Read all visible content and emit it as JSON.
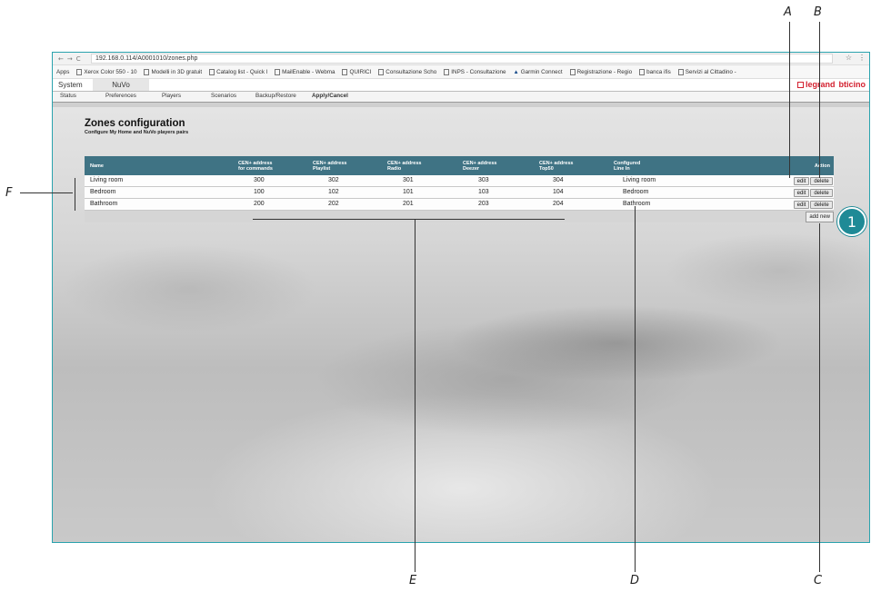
{
  "browser": {
    "url": "192.168.0.114/A0001010/zones.php",
    "bookmarks": [
      "Apps",
      "Xerox Color 550 - 10",
      "Modelli in 3D gratuit",
      "Catalog list - Quick l",
      "MailEnable - Webma",
      "QUIRICI",
      "Consultazione Scho",
      "INPS - Consultazione",
      "Garmin Connect",
      "Registrazione - Regio",
      "banca ifis",
      "Servizi al Cittadino -"
    ]
  },
  "app": {
    "tab_system": "System",
    "tab_nuvo": "NuVo",
    "brand_legrand": "legrand",
    "brand_bticino": "bticino"
  },
  "menu": [
    "Status",
    "Preferences",
    "Players",
    "Scenarios",
    "Backup/Restore",
    "Apply/Cancel"
  ],
  "page": {
    "title": "Zones configuration",
    "subtitle": "Configure My Home and NuVo players pairs"
  },
  "table": {
    "headers": {
      "name": "Name",
      "cmd_1": "CEN+ address",
      "cmd_2": "for commands",
      "pl_1": "CEN+ address",
      "pl_2": "Playlist",
      "radio_1": "CEN+ address",
      "radio_2": "Radio",
      "deezer_1": "CEN+ address",
      "deezer_2": "Deezer",
      "top_1": "CEN+ address",
      "top_2": "Top50",
      "line_1": "Configured",
      "line_2": "Line In",
      "action": "Action"
    },
    "rows": [
      {
        "name": "Living room",
        "cmd": "300",
        "playlist": "302",
        "radio": "301",
        "deezer": "303",
        "top": "304",
        "line_in": "Living room"
      },
      {
        "name": "Bedroom",
        "cmd": "100",
        "playlist": "102",
        "radio": "101",
        "deezer": "103",
        "top": "104",
        "line_in": "Bedroom"
      },
      {
        "name": "Bathroom",
        "cmd": "200",
        "playlist": "202",
        "radio": "201",
        "deezer": "203",
        "top": "204",
        "line_in": "Bathroom"
      }
    ],
    "edit_label": "edit",
    "delete_label": "delete",
    "add_new_label": "add new"
  },
  "callouts": {
    "a": "A",
    "b": "B",
    "c": "C",
    "d": "D",
    "e": "E",
    "f": "F",
    "badge": "1"
  }
}
